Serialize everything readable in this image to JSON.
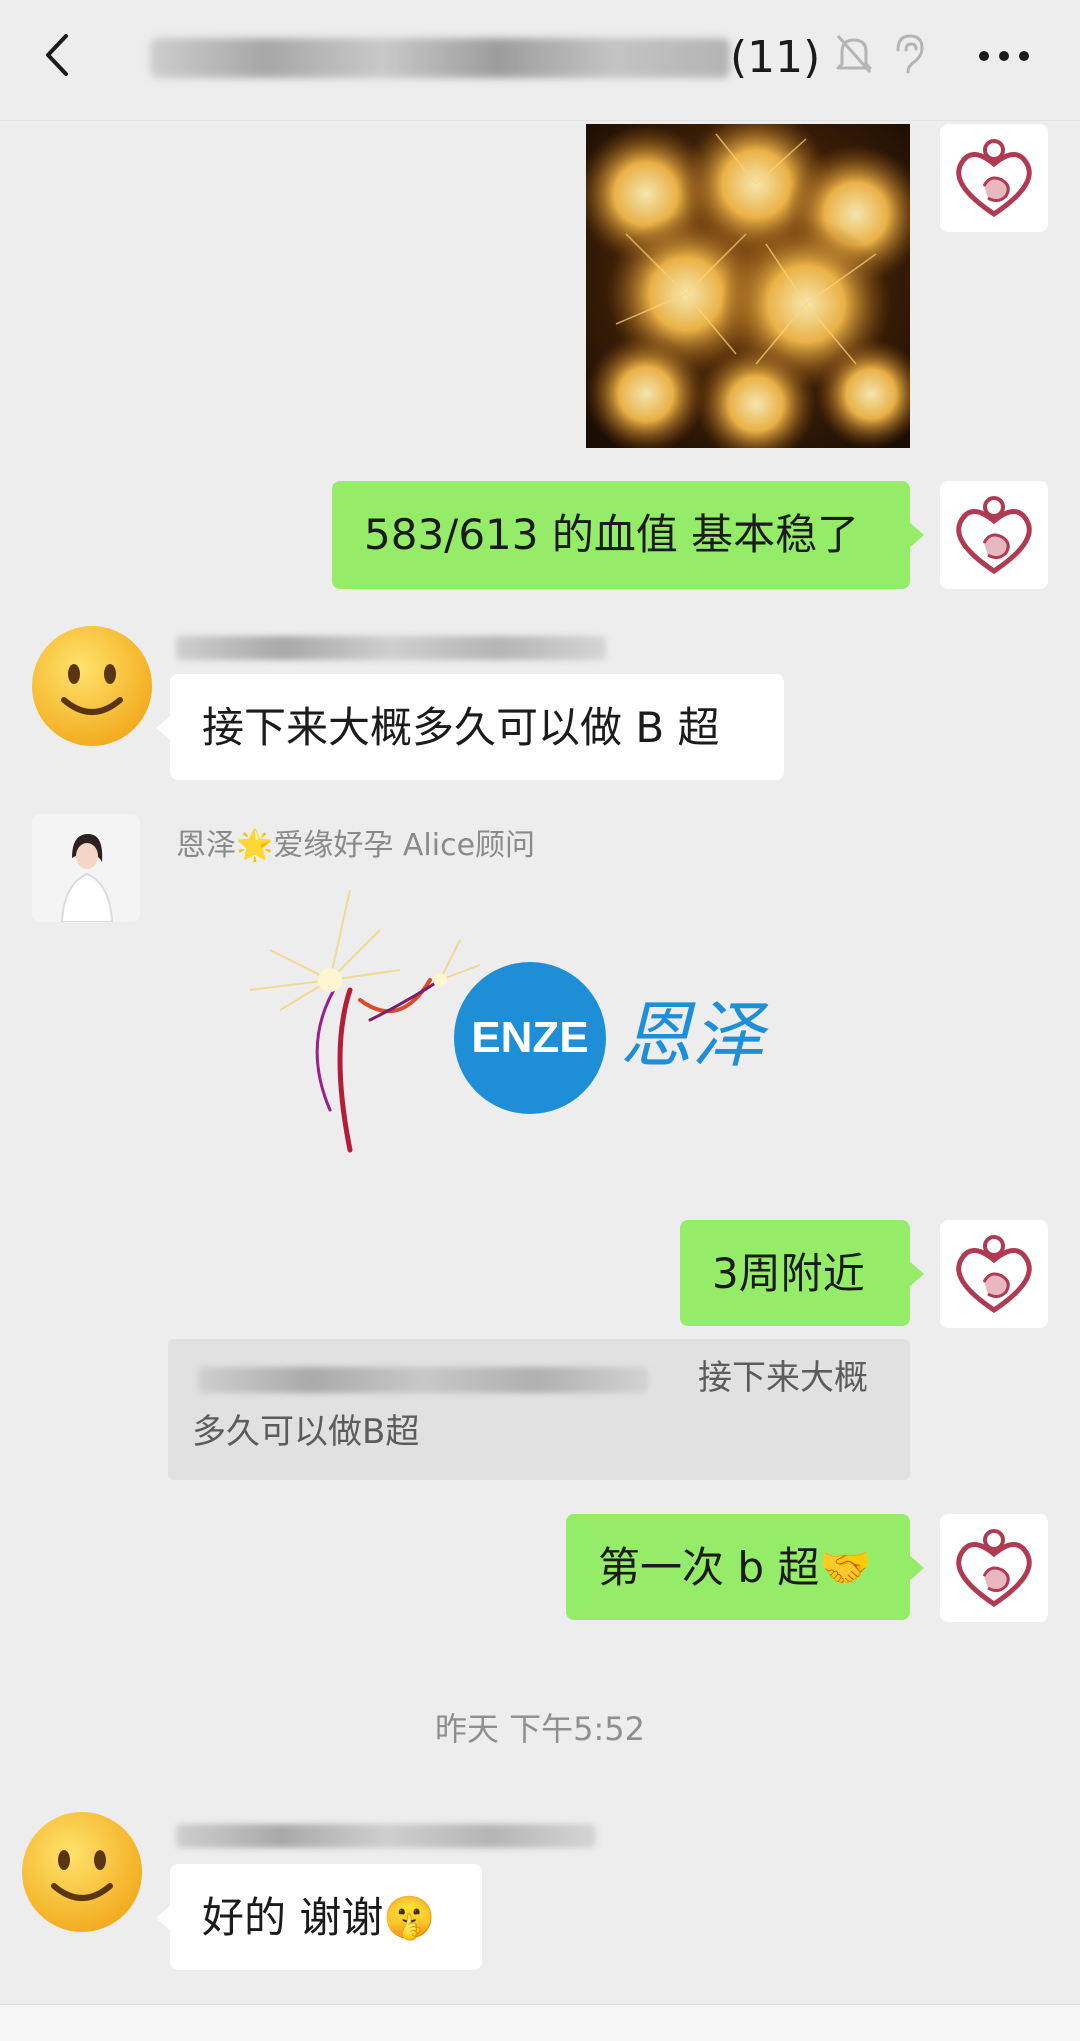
{
  "header": {
    "title_suffix": "(11)"
  },
  "messages": {
    "m2_text": "583/613 的血值 基本稳了",
    "m3_text": "接下来大概多久可以做 B 超",
    "m4_sender": "恩泽🌟爱缘好孕 Alice顾问",
    "m4_sticker_brand_latin": "ENZE",
    "m4_sticker_brand_cn": "恩泽",
    "m5_text": "3周附近",
    "m5_quote_line1": "接下来大概",
    "m5_quote_line2": "多久可以做B超",
    "m6_text": "第一次 b 超🤝",
    "m7_text": "好的 谢谢🤫"
  },
  "timestamp": "昨天 下午5:52",
  "colors": {
    "bubble_green": "#95ec69",
    "bubble_white": "#ffffff",
    "background": "#ededed",
    "brand_blue": "#1e8fd6",
    "logo_red": "#b03a52"
  }
}
